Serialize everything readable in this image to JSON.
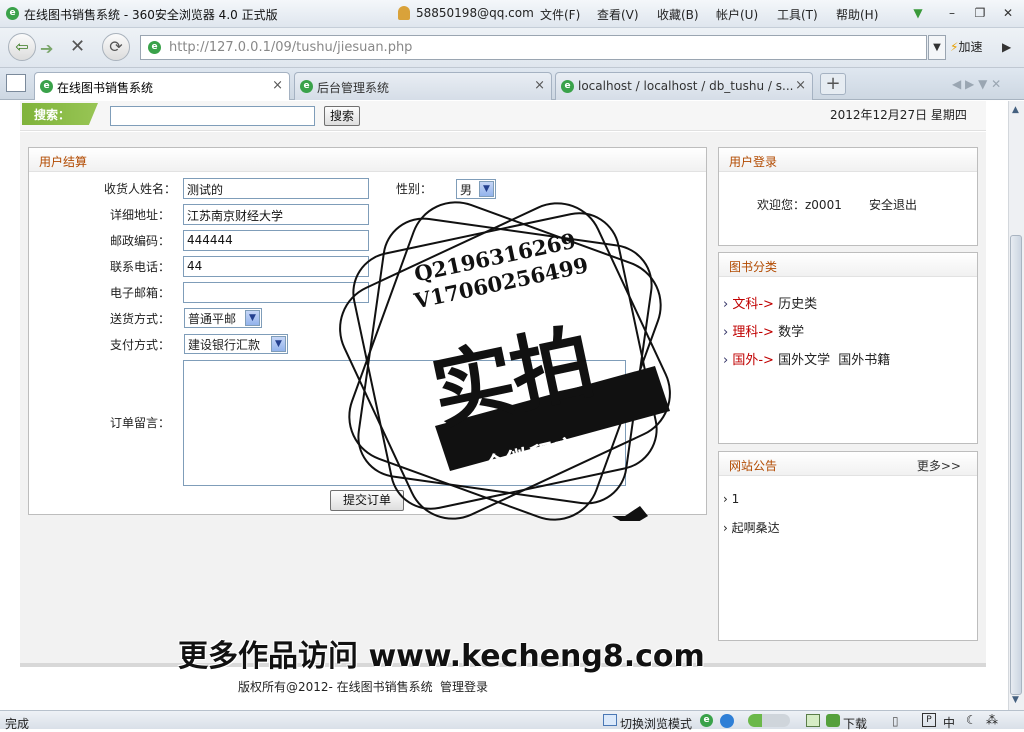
{
  "window": {
    "title": "在线图书销售系统 - 360安全浏览器 4.0 正式版",
    "account": "58850198@qq.com",
    "menus": [
      "文件(F)",
      "查看(V)",
      "收藏(B)",
      "帐户(U)",
      "工具(T)",
      "帮助(H)"
    ]
  },
  "navbar": {
    "url": "http://127.0.0.1/09/tushu/jiesuan.php",
    "accelerate": "加速"
  },
  "tabs": [
    {
      "label": "在线图书销售系统",
      "active": true
    },
    {
      "label": "后台管理系统",
      "active": false
    },
    {
      "label": "localhost / localhost / db_tushu / s...",
      "active": false
    }
  ],
  "search": {
    "label": "搜索：",
    "button": "搜索",
    "date": "2012年12月27日 星期四"
  },
  "checkout": {
    "title": "用户结算",
    "name_label": "收货人姓名：",
    "name_value": "测试的",
    "gender_label": "性别：",
    "gender_value": "男",
    "address_label": "详细地址：",
    "address_value": "江苏南京财经大学",
    "zip_label": "邮政编码：",
    "zip_value": "444444",
    "phone_label": "联系电话：",
    "phone_value": "44",
    "email_label": "电子邮箱：",
    "email_value": "",
    "shipping_label": "送货方式：",
    "shipping_value": "普通平邮",
    "payment_label": "支付方式：",
    "payment_value": "建设银行汇款",
    "message_label": "订单留言：",
    "submit": "提交订单"
  },
  "login": {
    "title": "用户登录",
    "welcome": "欢迎您：z0001",
    "logout": "安全退出"
  },
  "categories": {
    "title": "图书分类",
    "items": [
      {
        "main": "文科",
        "sub": [
          "历史类"
        ]
      },
      {
        "main": "理科",
        "sub": [
          "数学"
        ]
      },
      {
        "main": "国外",
        "sub": [
          "国外文学",
          "国外书籍"
        ]
      }
    ]
  },
  "notice": {
    "title": "网站公告",
    "more": "更多>>",
    "items": [
      "1",
      "起啊桑达"
    ]
  },
  "footer": {
    "copyright": "版权所有@2012- 在线图书销售系统",
    "admin_login": "管理登录"
  },
  "watermark": {
    "qq": "Q2196316269",
    "v": "V17060256499",
    "big": "实拍",
    "ribbon": "全微程序",
    "url_text": "更多作品访问 www.kecheng8.com"
  },
  "statusbar": {
    "left": "完成",
    "mode": "切换浏览模式",
    "download": "下载",
    "ime": "中"
  },
  "colors": {
    "accent_green": "#7fb33a",
    "heading_orange": "#b24a00",
    "category_red": "#c00000"
  }
}
